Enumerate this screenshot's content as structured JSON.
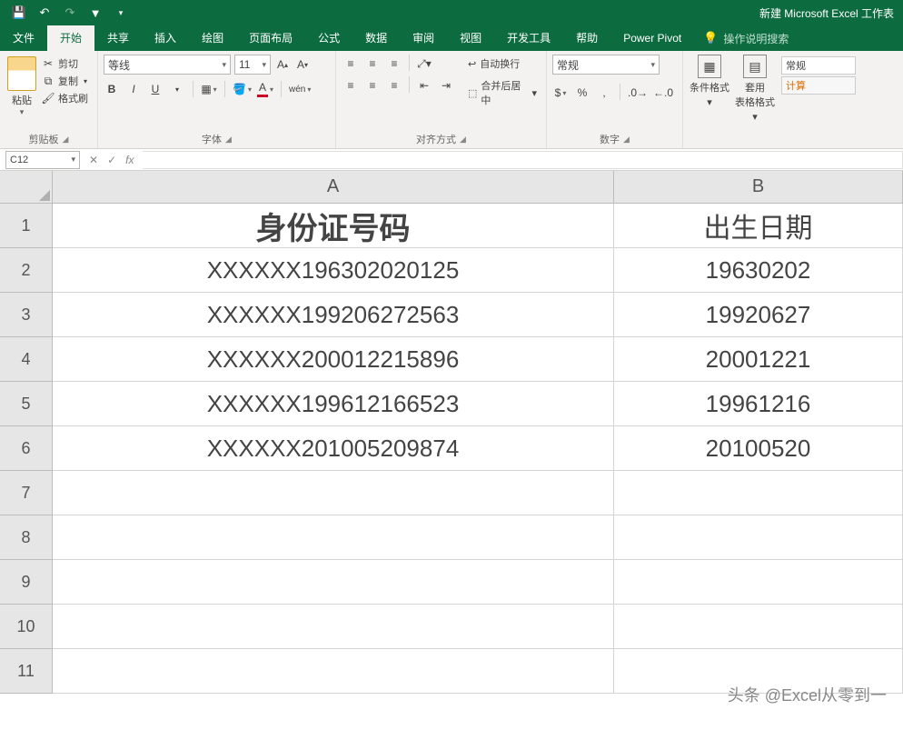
{
  "titlebar": {
    "title": "新建 Microsoft Excel 工作表"
  },
  "tabs": [
    "文件",
    "开始",
    "共享",
    "插入",
    "绘图",
    "页面布局",
    "公式",
    "数据",
    "审阅",
    "视图",
    "开发工具",
    "帮助",
    "Power Pivot"
  ],
  "active_tab": 1,
  "tellme": "操作说明搜索",
  "ribbon": {
    "clipboard": {
      "label": "剪贴板",
      "paste": "粘贴",
      "cut": "剪切",
      "copy": "复制",
      "fmt": "格式刷"
    },
    "font": {
      "label": "字体",
      "name": "等线",
      "size": "11",
      "bold": "B",
      "italic": "I",
      "underline": "U"
    },
    "align": {
      "label": "对齐方式",
      "wrap": "自动换行",
      "merge": "合并后居中"
    },
    "number": {
      "label": "数字",
      "format": "常规"
    },
    "styles": {
      "cond": "条件格式",
      "table": "套用\n表格格式",
      "gallery_normal": "常规",
      "gallery_calc": "计算"
    }
  },
  "namebox": "C12",
  "columns": [
    "A",
    "B"
  ],
  "rows": [
    {
      "n": "1",
      "a": "身份证号码",
      "b": "出生日期",
      "header": true
    },
    {
      "n": "2",
      "a": "XXXXXX196302020125",
      "b": "19630202"
    },
    {
      "n": "3",
      "a": "XXXXXX199206272563",
      "b": "19920627"
    },
    {
      "n": "4",
      "a": "XXXXXX200012215896",
      "b": "20001221"
    },
    {
      "n": "5",
      "a": "XXXXXX199612166523",
      "b": "19961216"
    },
    {
      "n": "6",
      "a": "XXXXXX201005209874",
      "b": "20100520"
    },
    {
      "n": "7",
      "a": "",
      "b": ""
    },
    {
      "n": "8",
      "a": "",
      "b": ""
    },
    {
      "n": "9",
      "a": "",
      "b": ""
    },
    {
      "n": "10",
      "a": "",
      "b": ""
    },
    {
      "n": "11",
      "a": "",
      "b": ""
    }
  ],
  "watermark": "头条 @Excel从零到一"
}
